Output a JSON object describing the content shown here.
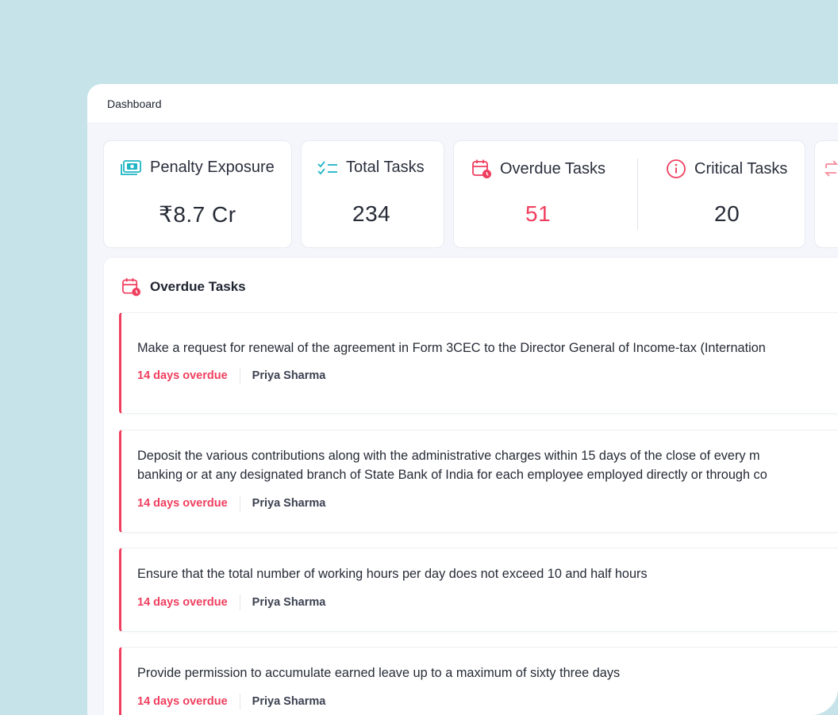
{
  "header": {
    "title": "Dashboard"
  },
  "stats": [
    {
      "label": "Penalty Exposure",
      "value": "₹8.7 Cr",
      "icon": "money-icon"
    },
    {
      "label": "Total Tasks",
      "value": "234",
      "icon": "checklist-icon"
    },
    {
      "label": "Overdue Tasks",
      "value": "51",
      "icon": "calendar-clock-icon"
    },
    {
      "label": "Critical Tasks",
      "value": "20",
      "icon": "info-icon"
    }
  ],
  "overdue_panel": {
    "title": "Overdue Tasks",
    "tasks": [
      {
        "text": "Make a request for renewal of the agreement in Form 3CEC to the Director General of Income-tax (Internation",
        "text2": "",
        "overdue": "14 days overdue",
        "assignee": "Priya Sharma"
      },
      {
        "text": "Deposit the various contributions along with the administrative charges within 15 days of the close of every m",
        "text2": "banking or at any designated branch of State Bank of India for each employee employed directly or through co",
        "overdue": "14 days overdue",
        "assignee": "Priya Sharma"
      },
      {
        "text": "Ensure that the total number of working hours per day does not exceed 10 and half hours",
        "text2": "",
        "overdue": "14 days overdue",
        "assignee": "Priya Sharma"
      },
      {
        "text": "Provide permission to accumulate earned leave up to a maximum of sixty three days",
        "text2": "",
        "overdue": "14 days overdue",
        "assignee": "Priya Sharma"
      }
    ]
  },
  "colors": {
    "accent_red": "#f03e5e",
    "accent_teal": "#1fb5c4",
    "background": "#c5e3e8"
  }
}
